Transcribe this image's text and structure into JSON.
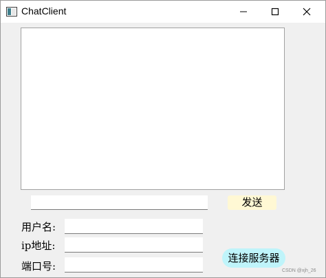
{
  "window": {
    "title": "ChatClient",
    "icon": "app-window-icon",
    "controls": [
      "minimize-icon",
      "maximize-icon",
      "close-icon"
    ]
  },
  "chat": {
    "log": "",
    "message_input_value": ""
  },
  "send_button": {
    "label": "发送",
    "color": "#fff8d4"
  },
  "form": {
    "username_label": "用户名:",
    "username_value": "",
    "ip_label": "ip地址:",
    "ip_value": "",
    "port_label": "端口号:",
    "port_value": ""
  },
  "connect_button": {
    "label": "连接服务器",
    "color": "#bff4fa"
  },
  "watermark": "CSDN @xjh_26"
}
